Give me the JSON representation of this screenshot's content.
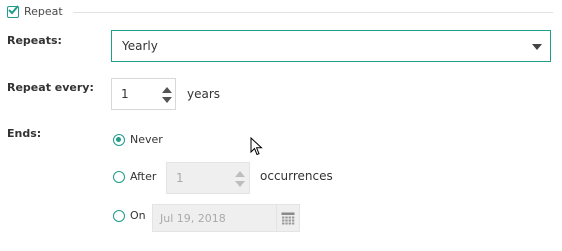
{
  "legend": {
    "label": "Repeat",
    "checked": true
  },
  "repeats": {
    "label": "Repeats:",
    "value": "Yearly"
  },
  "repeat_every": {
    "label": "Repeat every:",
    "value": "1",
    "unit": "years"
  },
  "ends": {
    "label": "Ends:",
    "never_label": "Never",
    "after_label": "After",
    "after_value": "1",
    "after_unit": "occurrences",
    "on_label": "On",
    "on_date": "Jul 19, 2018",
    "selected": "never"
  },
  "icons": {
    "checkbox": "check-icon",
    "dropdown": "chevron-down-icon",
    "calendar": "calendar-icon",
    "cursor": "mouse-pointer-icon"
  },
  "colors": {
    "accent": "#1e9d8b",
    "disabled_bg": "#efefef",
    "text": "#333333"
  }
}
